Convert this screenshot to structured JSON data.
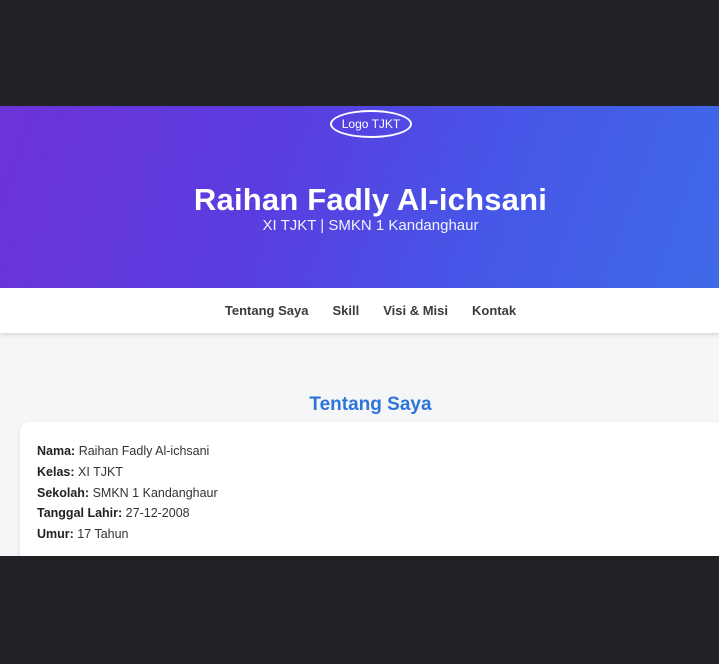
{
  "header": {
    "logo_alt": "Logo TJKT",
    "title": "Raihan Fadly Al-ichsani",
    "subtitle": "XI TJKT | SMKN 1 Kandanghaur"
  },
  "nav": {
    "items": [
      {
        "label": "Tentang Saya"
      },
      {
        "label": "Skill"
      },
      {
        "label": "Visi & Misi"
      },
      {
        "label": "Kontak"
      }
    ]
  },
  "about": {
    "title": "Tentang Saya",
    "rows": [
      {
        "label": "Nama:",
        "value": "Raihan Fadly Al-ichsani"
      },
      {
        "label": "Kelas:",
        "value": "XI TJKT"
      },
      {
        "label": "Sekolah:",
        "value": "SMKN 1 Kandanghaur"
      },
      {
        "label": "Tanggal Lahir:",
        "value": "27-12-2008"
      },
      {
        "label": "Umur:",
        "value": "17 Tahun"
      }
    ]
  },
  "colors": {
    "hero_gradient_start": "#6d33d9",
    "hero_gradient_end": "#3f6ae9",
    "section_title": "#2f74d9",
    "page_background": "#f4f6f8",
    "outer_background": "#202225"
  }
}
